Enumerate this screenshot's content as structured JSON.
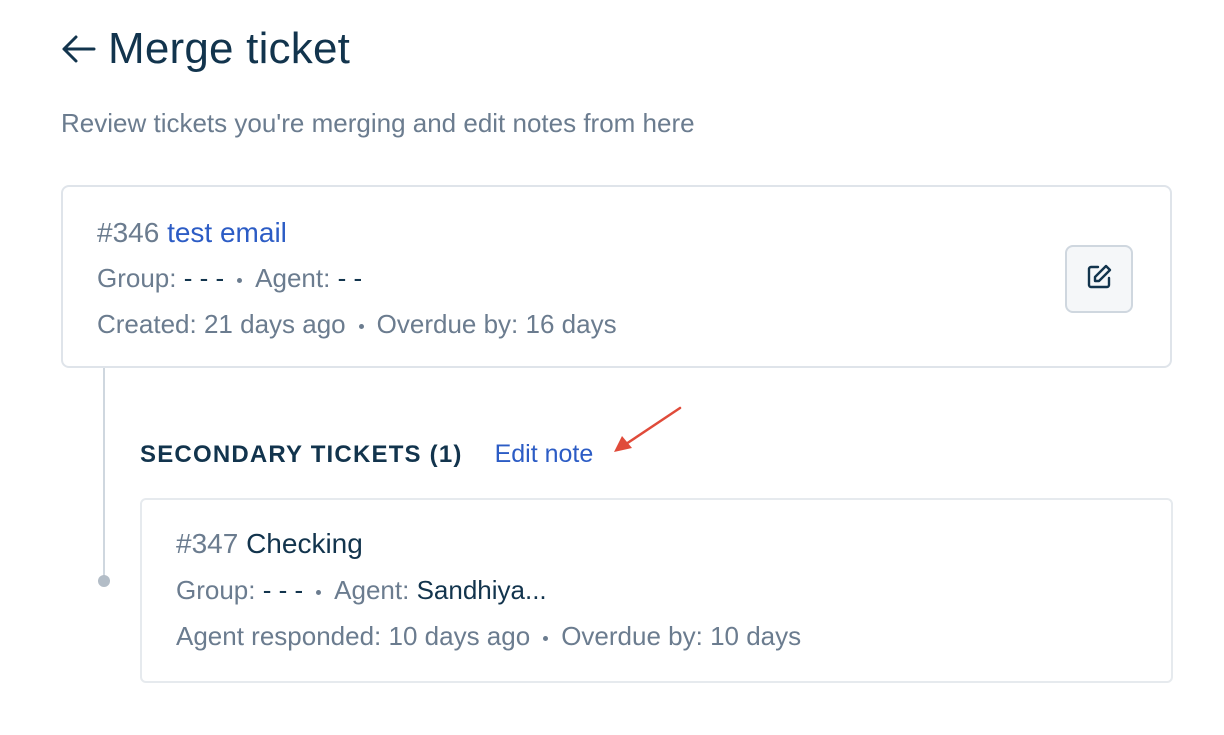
{
  "header": {
    "back_icon": "arrow-left-icon",
    "title": "Merge ticket",
    "subtitle": "Review tickets you're merging and edit notes from here"
  },
  "primary_ticket": {
    "id": "#346",
    "subject": "test email",
    "group_label": "Group:",
    "group_value": "- - -",
    "agent_label": "Agent:",
    "agent_value": "- -",
    "created_label": "Created:",
    "created_value": "21 days ago",
    "overdue_label": "Overdue by:",
    "overdue_value": "16 days",
    "edit_icon": "edit-icon"
  },
  "secondary": {
    "heading": "SECONDARY TICKETS (1)",
    "edit_note_label": "Edit note",
    "annotation_color": "#e04b3a",
    "ticket": {
      "id": "#347",
      "subject": "Checking",
      "group_label": "Group:",
      "group_value": "- - -",
      "agent_label": "Agent:",
      "agent_value": "Sandhiya...",
      "responded_label": "Agent responded:",
      "responded_value": "10 days ago",
      "overdue_label": "Overdue by:",
      "overdue_value": "10 days"
    }
  },
  "colors": {
    "heading": "#12344d",
    "muted": "#6b7c8f",
    "link": "#2c5cc5",
    "border": "#dfe4ea"
  }
}
